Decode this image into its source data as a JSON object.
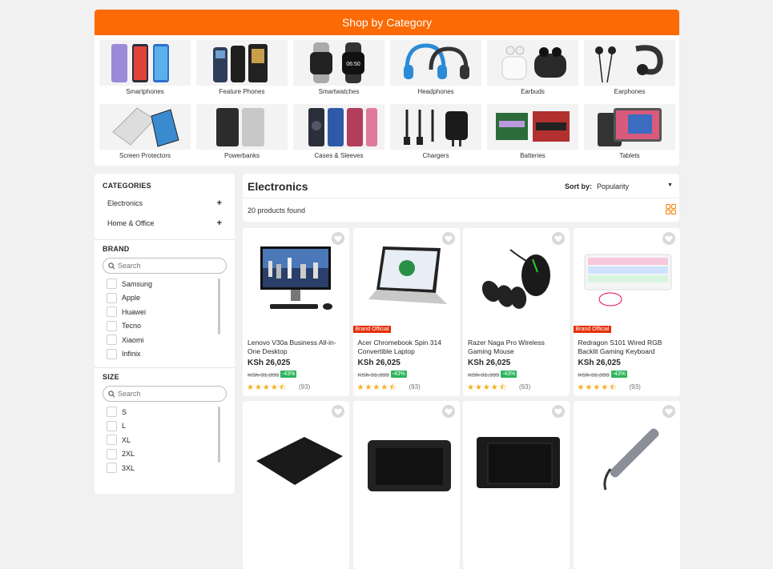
{
  "shop_by_category": {
    "title": "Shop by Category",
    "items": [
      {
        "label": "Smartphones",
        "icon": "smartphone-icon"
      },
      {
        "label": "Feature Phones",
        "icon": "feature-phone-icon"
      },
      {
        "label": "Smartwatches",
        "icon": "smartwatch-icon"
      },
      {
        "label": "Headphones",
        "icon": "headphones-icon"
      },
      {
        "label": "Earbuds",
        "icon": "earbuds-icon"
      },
      {
        "label": "Earphones",
        "icon": "earphones-icon"
      },
      {
        "label": "Screen Protectors",
        "icon": "screen-protector-icon"
      },
      {
        "label": "Powerbanks",
        "icon": "powerbank-icon"
      },
      {
        "label": "Cases & Sleeves",
        "icon": "phone-case-icon"
      },
      {
        "label": "Chargers",
        "icon": "charger-icon"
      },
      {
        "label": "Batteries",
        "icon": "battery-icon"
      },
      {
        "label": "Tablets",
        "icon": "tablet-icon"
      }
    ]
  },
  "sidebar": {
    "categories_heading": "CATEGORIES",
    "categories": [
      "Electronics",
      "Home & Office"
    ],
    "brand_heading": "BRAND",
    "brand_search_placeholder": "Search",
    "brands": [
      "Samsung",
      "Apple",
      "Huawei",
      "Tecno",
      "Xiaomi",
      "Infinix"
    ],
    "size_heading": "SIZE",
    "size_search_placeholder": "Search",
    "sizes": [
      "S",
      "L",
      "XL",
      "2XL",
      "3XL"
    ]
  },
  "main": {
    "title": "Electronics",
    "sort_label": "Sort by:",
    "sort_value": "Popularity",
    "products_found": "20 products found"
  },
  "products": [
    {
      "name": "Lenovo V30a Business All-in-One Desktop",
      "price": "KSh 26,025",
      "old_price": "KSh 31,399",
      "discount": "-43%",
      "rating": 4.5,
      "reviews": "(93)",
      "official": "",
      "icon": "desktop-icon"
    },
    {
      "name": "Acer Chromebook Spin 314 Convertible Laptop",
      "price": "KSh 26,025",
      "old_price": "KSh 31,399",
      "discount": "-43%",
      "rating": 4.5,
      "reviews": "(93)",
      "official": "Brand Official",
      "icon": "laptop-icon"
    },
    {
      "name": "Razer Naga Pro Wireless Gaming Mouse",
      "price": "KSh 26,025",
      "old_price": "KSh 31,399",
      "discount": "-43%",
      "rating": 4.5,
      "reviews": "(93)",
      "official": "",
      "icon": "mouse-icon"
    },
    {
      "name": "Redragon S101 Wired RGB Backlit Gaming Keyboard",
      "price": "KSh 26,025",
      "old_price": "KSh 31,399",
      "discount": "-43%",
      "rating": 4.5,
      "reviews": "(93)",
      "official": "Brand Official",
      "icon": "keyboard-icon"
    },
    {
      "name": "",
      "price": "",
      "old_price": "",
      "discount": "",
      "rating": 0,
      "reviews": "",
      "official": "",
      "icon": "mousepad-icon"
    },
    {
      "name": "",
      "price": "",
      "old_price": "",
      "discount": "",
      "rating": 0,
      "reviews": "",
      "official": "",
      "icon": "drawing-tablet-icon"
    },
    {
      "name": "",
      "price": "",
      "old_price": "",
      "discount": "",
      "rating": 0,
      "reviews": "",
      "official": "",
      "icon": "pen-tablet-icon"
    },
    {
      "name": "",
      "price": "",
      "old_price": "",
      "discount": "",
      "rating": 0,
      "reviews": "",
      "official": "",
      "icon": "usb-hub-icon"
    }
  ],
  "colors": {
    "accent": "#fb6a04",
    "discount": "#2bb55a",
    "official": "#e62e04",
    "star": "#f6b01e"
  }
}
